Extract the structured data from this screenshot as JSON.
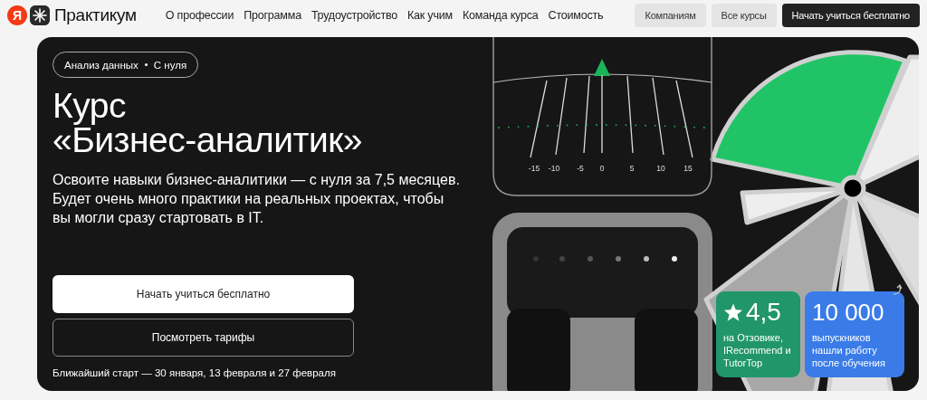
{
  "header": {
    "logo": {
      "letter": "Я",
      "name": "Практикум"
    },
    "nav": [
      "О профессии",
      "Программа",
      "Трудоустройство",
      "Как учим",
      "Команда курса",
      "Стоимость"
    ],
    "buttons": [
      {
        "label": "Компаниям",
        "kind": "secondary"
      },
      {
        "label": "Все курсы",
        "kind": "secondary"
      },
      {
        "label": "Начать учиться бесплатно",
        "kind": "primary"
      }
    ]
  },
  "hero": {
    "tags": [
      "Анализ данных",
      "С нуля"
    ],
    "title": [
      "Курс",
      "«Бизнес-аналитик»"
    ],
    "description": "Освоите навыки бизнес-аналитики — с нуля за 7,5 месяцев. Будет очень много практики на реальных проектах, чтобы вы могли сразу стартовать в IT.",
    "buttons": [
      {
        "label": "Начать учиться бесплатно",
        "kind": "primary"
      },
      {
        "label": "Посмотреть тарифы",
        "kind": "outline"
      }
    ],
    "start_note": "Ближайший старт — 30 января, 13 февраля и 27 февраля",
    "gauge": {
      "scale_labels": [
        "-15",
        "-10",
        "-5",
        "0",
        "5",
        "10",
        "15"
      ]
    },
    "badges": [
      {
        "kind": "rating",
        "value": "4,5",
        "text": "на Отзовике, IRecommend и TutorTop"
      },
      {
        "kind": "count",
        "value": "10 000",
        "text": "выпускников нашли работу после обучения"
      }
    ]
  }
}
